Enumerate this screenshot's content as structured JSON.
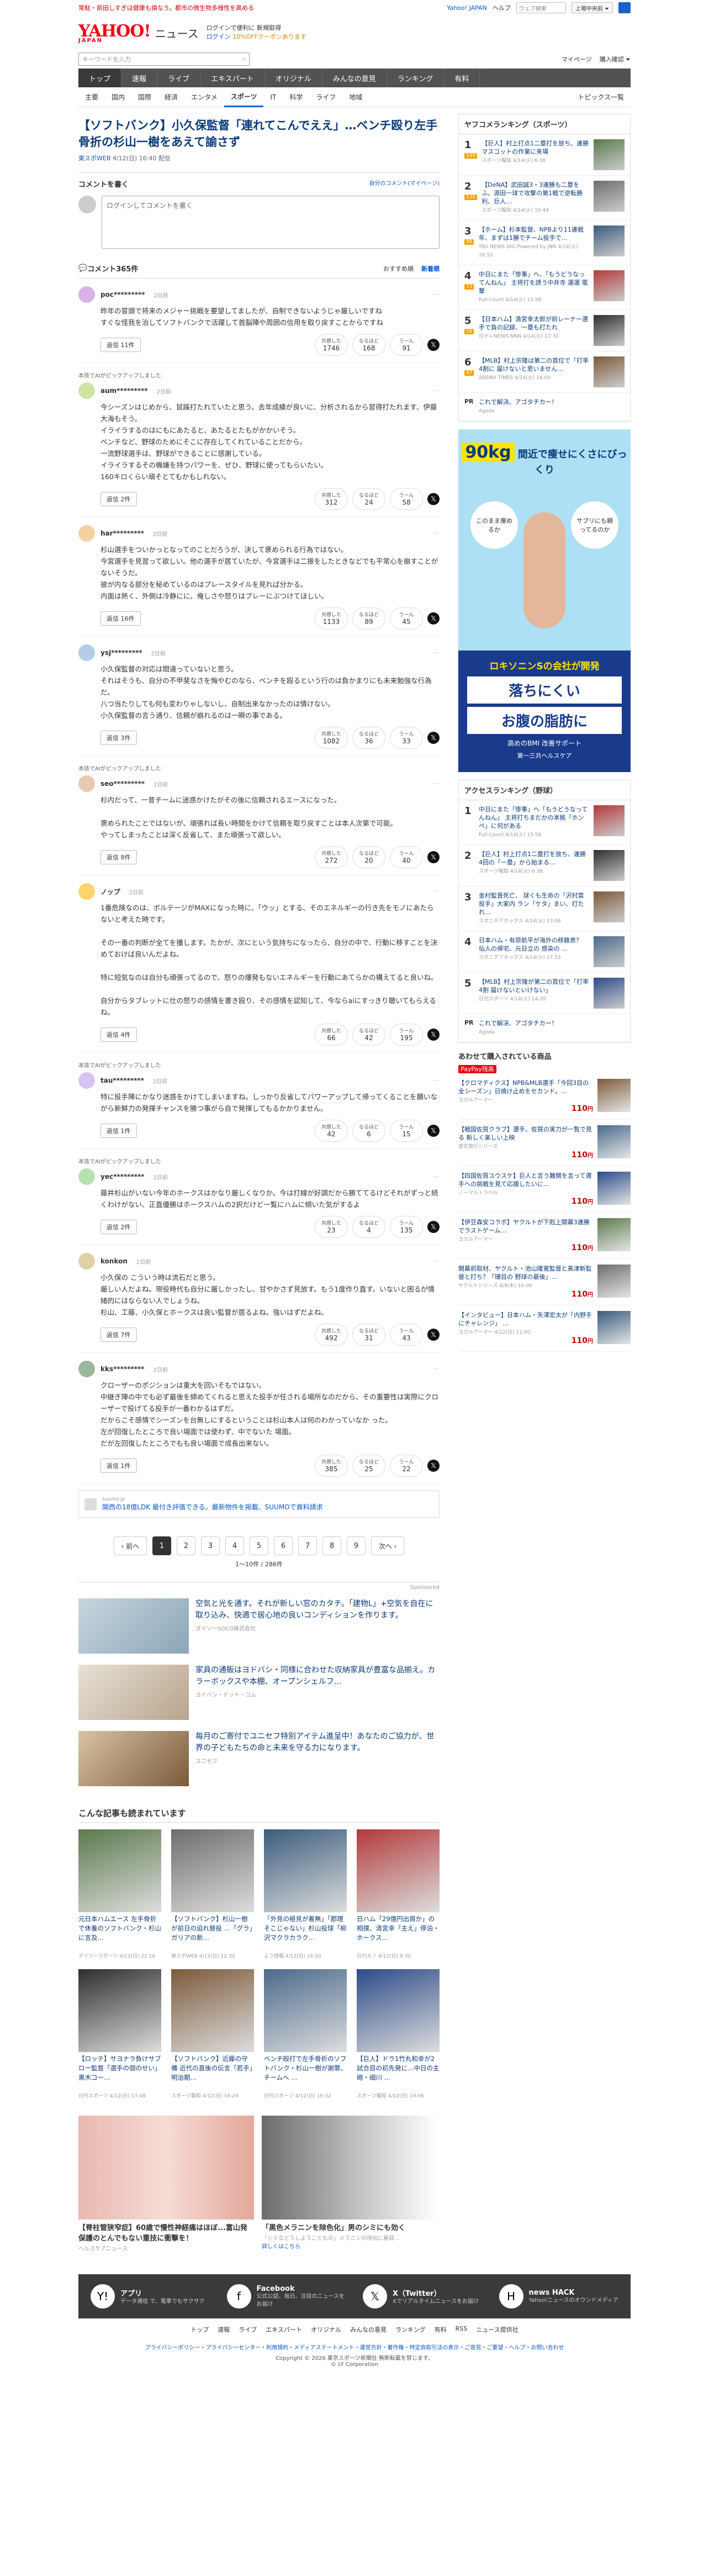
{
  "promo": {
    "text": "常駐・前田しすぎは健康も損なう。都市の微生物多様性を高める",
    "yahoo_japan": "Yahoo! JAPAN",
    "help": "ヘルプ",
    "search_placeholder": "ウェブ検索",
    "shop_btn": "上場中央前 ⏷"
  },
  "header": {
    "logo": "YAHOO!",
    "logo_sub": "JAPAN",
    "brand": "ニュース",
    "line1": "ログインで便利に 新規取得",
    "line2": "ログイン",
    "coupon": "10%OFFクーポンあります"
  },
  "search": {
    "placeholder": "キーワードを入力",
    "mypage": "マイページ",
    "login_link": "購入確認 ⏷"
  },
  "gnav": [
    "トップ",
    "速報",
    "ライブ",
    "エキスパート",
    "オリジナル",
    "みんなの意見",
    "ランキング",
    "有料"
  ],
  "snav": [
    "主要",
    "国内",
    "国際",
    "経済",
    "エンタメ",
    "スポーツ",
    "IT",
    "科学",
    "ライフ",
    "地域"
  ],
  "snav_right": "トピックス一覧",
  "article": {
    "title": "【ソフトバンク】小久保監督「連れてこんでええ」…ベンチ殴り左手骨折の杉山一樹をあえて諭さず",
    "source": "東スポWEB",
    "date": "4/12(日) 16:40",
    "tag": "配信"
  },
  "comment_write": {
    "title": "コメントを書く",
    "right": "自分のコメント(マイページ)",
    "placeholder": "ログインしてコメントを書く"
  },
  "clist": {
    "title": "コメント365件",
    "sort_recommended": "おすすめ順",
    "sort_new": "新着順"
  },
  "comments": [
    {
      "user": "poc*********",
      "time": "2日前",
      "badge": "",
      "text": "昨年の冒頭で将来のメジャー挑戦を要望してましたが、自制できないようじゃ厳しいですね\nすぐな怪我を治してソフトバンクで活躍して首脳陣や周囲の信用を取り戻すことからですね",
      "reply": "返信 11件",
      "like": "1746",
      "agree": "168",
      "hmm": "91"
    },
    {
      "user": "aum*********",
      "time": "2日前",
      "badge": "本技でAIがピックアップしました",
      "text": "今シーズンはじめから、鼠蹊打たれていたと思う。去年成績が良いに、分析されるから習得打たれます、伊藤大海もそう。\nイライラするのはにもにあたると、あたるとたもがかかいそう。\nベンチなど、野球のためにそこに存在してくれていることだから。\n一流野球選手は、野球ができることに感謝している。\nイライラするその機嫌を持つパワーを、ぜひ、野球に使ってもらいたい。\n160キロくらい頑そとてもかもしれない。",
      "reply": "返信 2件",
      "like": "312",
      "agree": "24",
      "hmm": "58"
    },
    {
      "user": "har*********",
      "time": "2日前",
      "badge": "",
      "text": "杉山選手をついかっとなってのことだろうが、決して褒められる行為ではない。\n今宮選手を見習って欲しい。他の選手が居ていたが、今宮選手は二振をしたときなどでも平常心を崩すことがないそうだ。\n彼が内なる部分を秘めているのはプレースタイルを見れば分かる。\n内面は熱く、外側は冷静にに、俺しさや怒りはプレーにぶつけてほしい。",
      "reply": "返信 16件",
      "like": "1133",
      "agree": "89",
      "hmm": "45"
    },
    {
      "user": "ysj*********",
      "time": "2日前",
      "badge": "",
      "text": "小久保監督の対応は間違っていないと思う。\nそれはそうも、自分の不甲斐なさを悔やむのなら、ベンチを殴るという行のは負かまりにも未来勉強な行為だ。\n八つ当たりしても何も変わりゃしないし、自制出来なかったのは情けない。\n小久保監督の言う通り、信頼が崩れるのは一瞬の事である。",
      "reply": "返信 3件",
      "like": "1082",
      "agree": "36",
      "hmm": "33"
    },
    {
      "user": "seo*********",
      "time": "2日前",
      "badge": "本技でAIがピックアップしました",
      "text": "杉内だって、一昔チームに迷惑かけたがその後に信頼されるエースになった。\n\n褒められたことではないが、頑張れば長い時間をかけて信頼を取り戻すことは本人次第で可能。\nやってしまったことは深く反省して、また頑張って欲しい。",
      "reply": "返信 8件",
      "like": "272",
      "agree": "20",
      "hmm": "40"
    },
    {
      "user": "ノップ",
      "time": "2日前",
      "badge": "",
      "text": "1番危険なのは、ボルテージがMAXになった時に、「ウッ」とする、そのエネルギーの行き先をモノにあたらないと考えた時です。\n\nその一番の判断が全てを播します。たかが、次にという気持ちになったら、自分の中で、行動に移すことを決めておけば良いんだよね。\n\n特に短気なのは自分も頑張ってるので、怒りの爆発もないエネルギーを行動にあてらかの構えてると良いね。\n\n自分からタブレットに仕の怒りの感情を書き殴り、その感情を認知して、今ならaiにすっきり聴いてもらえるね。",
      "reply": "返信 4件",
      "like": "66",
      "agree": "42",
      "hmm": "195"
    },
    {
      "user": "tau*********",
      "time": "2日前",
      "badge": "本技でAIがピックアップしました",
      "text": "特に投手陣にかなり迷惑をかけてしまいますね。しっかり反省してパワーアップして帰ってくることを願いながら新鮮力の発揮チャンスを勝つ事がら自で発揮してもるかかりません。",
      "reply": "返信 1件",
      "like": "42",
      "agree": "6",
      "hmm": "15"
    },
    {
      "user": "yec*********",
      "time": "2日前",
      "badge": "本技でAIがピックアップしました",
      "text": "藤井杉山がいない今年のホークスはかなり厳しくなりか。今は打線が好調だから勝ててるけどそれがずっと続くわけがない、正直優勝はホークスハムの2択だけど一覧にハムに傾いた気がするよ",
      "reply": "返信 2件",
      "like": "23",
      "agree": "4",
      "hmm": "135"
    },
    {
      "user": "konkon",
      "time": "2日前",
      "badge": "",
      "text": "小久保の こういう時は流石だと思う。\n厳しい人だよね。現役時代も自分に厳しかったし、甘やかさず見放す。もう1度作り直す。いないと困るが情緒的にはならない人でしょうね。\n杉山、工藤、小久保とホークスは良い監督が居るよね。強いはずだよね。",
      "reply": "返信 7件",
      "like": "492",
      "agree": "31",
      "hmm": "43"
    },
    {
      "user": "kks*********",
      "time": "2日前",
      "badge": "",
      "text": "クローザーのポジションは重大を回いそもではない。\n中継ぎ陣の中でも必ず最後を締めてくれると思えた投手が任される場所なのだから、その重要性は実際にクローザーで投げてる投手が一番わかるはずだ。\nだからこそ感情でシーズンを台無しにするということは杉山本人は何のわかっていなか った。\n左が回復したところで良い場面では使わず、中でないた 場面。\nだが左回復したところでもも良い場面で成長出来ない。",
      "reply": "返信 1件",
      "like": "385",
      "agree": "25",
      "hmm": "22"
    }
  ],
  "react_labels": {
    "like": "共感した",
    "agree": "なるほど",
    "hmm": "うーん"
  },
  "inline_ad": {
    "title": "関西の18億LDK 最付き評価できる。最新物件を掲載、SUUMOで資料請求",
    "src": "suumo.jp"
  },
  "pager": {
    "prev": "‹ 前へ",
    "pages": [
      "1",
      "2",
      "3",
      "4",
      "5",
      "6",
      "7",
      "8",
      "9"
    ],
    "next": "次へ ›",
    "count": "1〜10件 / 286件"
  },
  "sponsor_label": "Sponsored",
  "sponsored": [
    {
      "title": "空気と光を通す。それが新しい窓のカタチ。「建物L」+空気を自在に取り込み、快適で居心地の良いコンディションを作ります。",
      "src": "ダイソーSOCO株式会社"
    },
    {
      "title": "家具の通販はヨドバシ・同様に合わせた収納家具が豊富な品揃え。カラーボックスや本棚、オープンシェルフ...",
      "src": "ヨドバシ・ドット・コム"
    },
    {
      "title": "毎月のご寄付でユニセフ特別アイテム進呈中！あなたのご協力が、世界の子どもたちの命と未来を守る力になります。",
      "src": "ユニセフ"
    }
  ],
  "related_title": "こんな記事も読まれています",
  "related": [
    {
      "title": "元日本ハムエース 左手骨折で休養のソフトバンク・杉山に言及…",
      "src": "デイリースポーツ 4/12(日) 22:16"
    },
    {
      "title": "【ソフトバンク】杉山一樹が前日の迫れ替投 …「グラ」ガリアの新…",
      "src": "東スポWEB 4/12(日) 12:30"
    },
    {
      "title": "「外見の極見が着無」「郡理そこじゃない」杉山投球「柳沢マクラカラク…",
      "src": "よう情報 4/12(日) 16:00"
    },
    {
      "title": "日ハム「29億円出資か」の相撲、清宮幸「主え」停泊・ホークス…",
      "src": "日刊大ノ 4/12(日) 9:30"
    },
    {
      "title": "【ロッテ】サヨナラ負けサブロー監督「選手の個のせい」黒木コー…",
      "src": "日刊スポーツ 4/12(日) 17:49"
    },
    {
      "title": "【ソフトバンク】近藤の守備 近代の直後の伝言「若手」明治期…",
      "src": "スポーツ報知 4/12(日) 16:29"
    },
    {
      "title": "ベンチ殴打で左手骨折のソフトバンク・杉山一樹が謝罪、チームへ …",
      "src": "日刊スポーツ 4/12(日) 16:32"
    },
    {
      "title": "【巨人】ドラ1竹丸和幸が2試合目の初先発に…中日の主砲・細川 …",
      "src": "スポーツ報知 4/12(日) 19:06"
    }
  ],
  "twin_ads": [
    {
      "title": "【脊柱管狭窄症】60歳で慢性神経痛はほぼ...富山発保護のとんでもない重技に衝撃を！",
      "src": "ヘルスケアニュース"
    },
    {
      "title": "「黒色メラニンを除色化」男のシミにも効く",
      "src": "「シミなどうしようこともの」メラニンの排出に着目...",
      "sub": "詳しくはこちら"
    }
  ],
  "side": {
    "rank_title": "ヤフコメランキング（スポーツ）",
    "ranking": [
      {
        "no": "1",
        "count": "249",
        "title": "【巨人】村上打点1二塁打を放ち、連勝 マスコットの作業に来場",
        "src": "スポーツ報知 4/14(火) 6:38"
      },
      {
        "no": "2",
        "count": "135",
        "title": "【DeNA】武田誠3・3連勝も二塁をふ、源田一球で攻撃の第1戦で逆転勝利、巨人…",
        "src": "スポーツ報知 4/14(火) 10:44"
      },
      {
        "no": "3",
        "count": "98",
        "title": "【ホーム】杉本監督、NPBより11連戦年、まずは1勝でチーム投手で…",
        "src": "TBS NEWS DIG Powered by JNN 4/14(火) 16:51"
      },
      {
        "no": "4",
        "count": "73",
        "title": "中日にまた「惨事」へ、「もうどうなってんねん」 主将打を誘う中井寺 運運 電撃",
        "src": "Full-Count 4/14(火) 15:58"
      },
      {
        "no": "5",
        "count": "56",
        "title": "【日本ハム】清宮幸太郎が前レーナー選手で負の記録、一塁も打たれ",
        "src": "日テレNEWS NNN 4/14(火) 17:30"
      },
      {
        "no": "6",
        "count": "47",
        "title": "【MLB】村上宗隆は第二の首位で「打率 4割に 届けないと思いません…",
        "src": "ABEMA TIMES 4/14(火) 14:00"
      }
    ],
    "pr_text": "これで解決、アゴタチカー！",
    "pr_src": "Agoda",
    "ad_kg": "90kg",
    "ad_top": "間近で痩せにくさにびっくり",
    "ad_bubble1": "このまま痩めるか",
    "ad_bubble2": "サプリにも頼ってるのか",
    "ad_bottom1": "ロキソニンSの会社が開発",
    "ad_bottom2": "落ちにくい",
    "ad_bottom3": "お腹の脂肪に",
    "ad_bottom4": "高めのBMI 改善サポート",
    "ad_brand": "第一三共ヘルスケア",
    "access_title": "アクセスランキング（野球）",
    "access": [
      {
        "no": "1",
        "title": "中日にまた「惨事」へ「もうどうなってんねん」 主将打ちまだかの本拠「ホンペ」に何がある",
        "src": "Full-Count 4/14(火) 15:58"
      },
      {
        "no": "2",
        "title": "【巨人】村上打点1二塁打を放ち、連勝 4回の「一塁」から始まる…",
        "src": "スポーツ報知 4/14(火) 6:38"
      },
      {
        "no": "3",
        "title": "金村監督死亡、 球くも生命の「沢村賞投手」大家内 ラン「ケタ」まい、打たれ…",
        "src": "スポニチアネックス 4/14(火) 13:06"
      },
      {
        "no": "4",
        "title": "日本ハム・有原航平が海外の移籍表？ 仙人の帰宅、元日立の 感染の …",
        "src": "スポニチアネックス 4/14(火) 17:53"
      },
      {
        "no": "5",
        "title": "【MLB】村上宗隆が第二の首位で「打率 4割 届けないといけない」",
        "src": "日刊スポーツ 4/14(火) 14:20"
      }
    ],
    "pr2_text": "これで解決、アゴタチカー！",
    "shop_title": "あわせて購入されている商品",
    "shop_sub": "PayPay残高",
    "shop": [
      {
        "title": "【クロマティクス】NPB&MLB選手「今回3目の全シーズン」日焼け止めをセカンド。…",
        "src": "ヨカルアーマー",
        "price": "110",
        "unit": "円"
      },
      {
        "title": "【戦国佐賀クラブ】選手、佐賀の実力が一覧で見る 新しく楽しい上映",
        "src": "遊花旅行シリーズ",
        "price": "110",
        "unit": "円"
      },
      {
        "title": "【四国佐賀ユウスケ】巨人と言う難関を言って選手への挑戦を見て応援したいに…",
        "src": "ノーマルトラベル",
        "price": "110",
        "unit": "円"
      },
      {
        "title": "【伊豆森安コラボ】ヤクルトが下剋上開幕3連勝でラストゲーム…",
        "src": "ヨカルアーマー",
        "price": "110",
        "unit": "円"
      },
      {
        "title": "開幕前取材、ヤクルト・池山隆寛監督と髙津新監督と打ち？「珊目の 野球の最後」…",
        "src": "ヤクルトシリーズ 4/9(木) 16:00",
        "price": "110",
        "unit": "円"
      },
      {
        "title": "【インタビュー】日本ハム・矢澤宏太が「内野手にチャレンジ」 …",
        "src": "ヨカルアーマー 4/12(日) 11:00",
        "price": "110",
        "unit": "円"
      }
    ]
  },
  "footer": {
    "apps": [
      {
        "title": "アプリ",
        "desc": "データ通信 で、電車でもサクサク"
      },
      {
        "title": "Facebook",
        "desc": "公式公認、毎日、注目のニュースをお届け"
      },
      {
        "title": "X（Twitter）",
        "desc": "Xでリアルタイムニュースをお届け"
      },
      {
        "title": "news HACK",
        "desc": "Yahoo!ニュースのオウンドメディア"
      }
    ],
    "nav": [
      "トップ",
      "速報",
      "ライブ",
      "エキスパート",
      "オリジナル",
      "みんなの意見",
      "ランキング",
      "有料",
      "RSS",
      "ニュース提供社"
    ],
    "legal": "プライバシーポリシー・プライバシーセンター・利用規約・メディアステートメント・運営方針・著作権・特定商取引法の表示・ご意見・ご要望・ヘルプ・お問い合わせ",
    "copyright": "Copyright © 2026 東京スポーツ新聞社 無断転載を禁じます。",
    "corp": "© LY Corporation"
  }
}
